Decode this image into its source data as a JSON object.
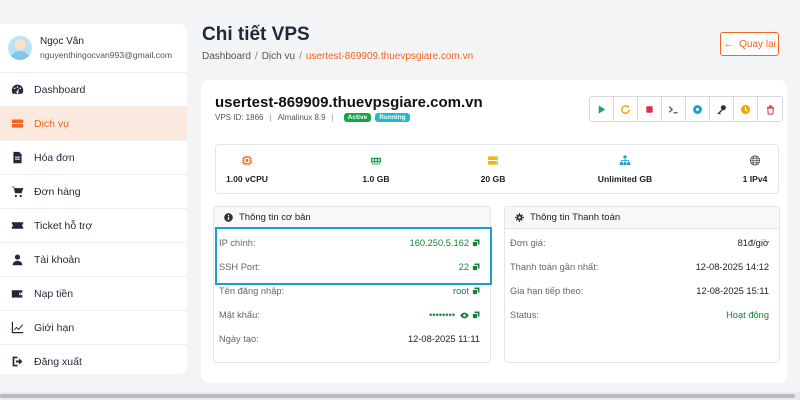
{
  "user": {
    "name": "Ngọc Vân",
    "email": "nguyenthingocvan993@gmail.com"
  },
  "nav": [
    {
      "label": "Dashboard",
      "icon": "dashboard-icon"
    },
    {
      "label": "Dịch vụ",
      "icon": "server-icon",
      "active": true
    },
    {
      "label": "Hóa đơn",
      "icon": "invoice-icon"
    },
    {
      "label": "Đơn hàng",
      "icon": "cart-icon"
    },
    {
      "label": "Ticket hỗ trợ",
      "icon": "ticket-icon"
    },
    {
      "label": "Tài khoản",
      "icon": "user-icon"
    },
    {
      "label": "Nạp tiền",
      "icon": "wallet-icon"
    },
    {
      "label": "Giới hạn",
      "icon": "chart-icon"
    },
    {
      "label": "Đăng xuất",
      "icon": "logout-icon"
    }
  ],
  "header": {
    "title": "Chi tiết VPS",
    "breadcrumb": [
      "Dashboard",
      "Dịch vụ",
      "usertest-869909.thuevpsgiare.com.vn"
    ],
    "back_label": "Quay lại"
  },
  "vps": {
    "hostname": "usertest-869909.thuevpsgiare.com.vn",
    "vps_id": "VPS ID: 1866",
    "os": "Almalinux 8.9",
    "badges": [
      "Active",
      "Running"
    ]
  },
  "actions": [
    "play-icon",
    "refresh-icon",
    "stop-icon",
    "terminal-icon",
    "disc-icon",
    "key-icon",
    "clock-icon",
    "trash-icon"
  ],
  "specs": [
    {
      "icon": "cpu-icon",
      "value": "1.00 vCPU"
    },
    {
      "icon": "memory-icon",
      "value": "1.0 GB"
    },
    {
      "icon": "disk-icon",
      "value": "20 GB"
    },
    {
      "icon": "network-icon",
      "value": "Unlimited GB"
    },
    {
      "icon": "globe-icon",
      "value": "1 IPv4"
    }
  ],
  "basic_info": {
    "title": "Thông tin cơ bản",
    "rows": [
      {
        "label": "IP chính:",
        "value": "160.250.5.162"
      },
      {
        "label": "SSH Port:",
        "value": "22"
      },
      {
        "label": "Tên đăng nhập:",
        "value": "root"
      },
      {
        "label": "Mật khẩu:",
        "value": "••••••••"
      },
      {
        "label": "Ngày tạo:",
        "value": "12-08-2025 11:11"
      }
    ]
  },
  "billing_info": {
    "title": "Thông tin Thanh toán",
    "rows": [
      {
        "label": "Đơn giá:",
        "value": "81đ/giờ"
      },
      {
        "label": "Thanh toán gần nhất:",
        "value": "12-08-2025 14:12"
      },
      {
        "label": "Gia hạn tiếp theo:",
        "value": "12-08-2025 15:11"
      },
      {
        "label": "Status:",
        "value": "Hoạt động"
      }
    ]
  },
  "colors": {
    "accent": "#f26522",
    "green": "#15803d",
    "highlight": "#1aa0c8"
  }
}
